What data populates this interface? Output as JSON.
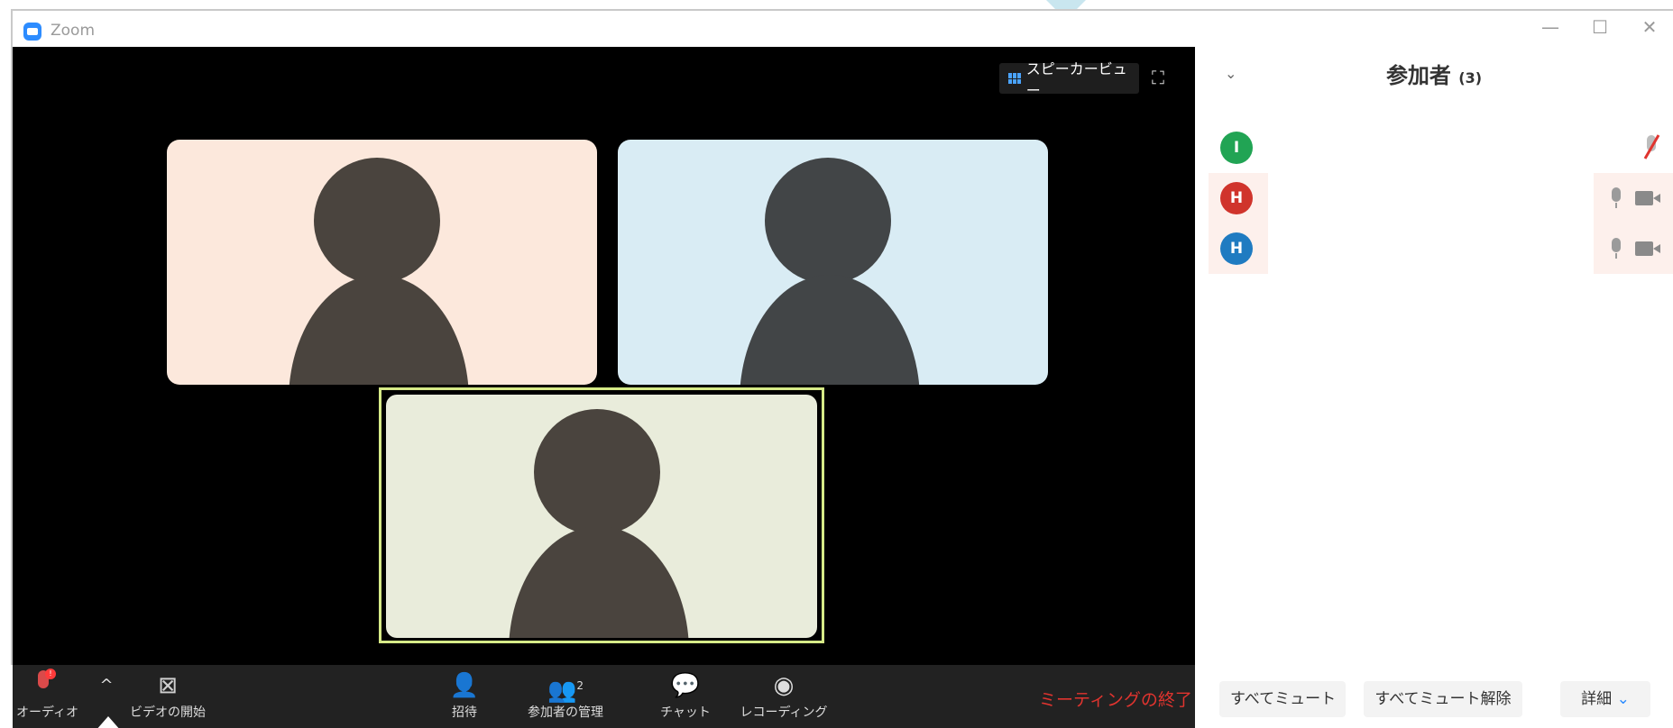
{
  "window": {
    "title": "Zoom",
    "minimize_glyph": "—",
    "maximize_glyph": "☐",
    "close_glyph": "✕"
  },
  "video": {
    "view_toggle_label": "スピーカービュー",
    "fullscreen_glyph": "⛶",
    "tiles": [
      {
        "bg": "#fce8dc",
        "silhouette": "#4a443e"
      },
      {
        "bg": "#d9ecf4",
        "silhouette": "#424547"
      },
      {
        "bg": "#e9ecdb",
        "silhouette": "#4a443e",
        "active_speaker": true,
        "border": "#d6ea87"
      }
    ]
  },
  "toolbar": {
    "audio_label": "オーディオ",
    "audio_badge": "!",
    "audio_caret": "^",
    "video_label": "ビデオの開始",
    "invite_label": "招待",
    "participants_label": "参加者の管理",
    "participants_count": "2",
    "chat_label": "チャット",
    "recording_label": "レコーディング",
    "end_meeting_label": "ミーティングの終了",
    "end_color": "#e0342f"
  },
  "panel": {
    "collapse_glyph": "⌄",
    "title": "参加者",
    "count": "(3)",
    "participants": [
      {
        "initial": "I",
        "avatar_color": "#21a454",
        "audio": "muted",
        "row_bg": "#ffffff"
      },
      {
        "initial": "H",
        "avatar_color": "#d0342c",
        "audio": "on",
        "video": "on",
        "row_bg": "#fdf0ec"
      },
      {
        "initial": "H",
        "avatar_color": "#1f7bc1",
        "audio": "on",
        "video": "on",
        "row_bg": "#fdf0ec"
      }
    ],
    "mute_all_label": "すべてミュート",
    "unmute_all_label": "すべてミュート解除",
    "more_label": "詳細",
    "more_caret": "⌄"
  }
}
